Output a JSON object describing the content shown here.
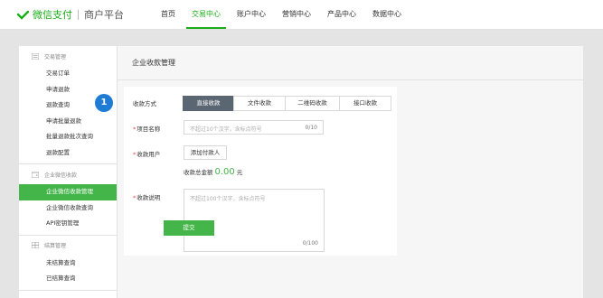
{
  "brand": {
    "name": "微信支付",
    "sub": "商户平台",
    "color": "#1aad19"
  },
  "nav": [
    "首页",
    "交易中心",
    "账户中心",
    "营销中心",
    "产品中心",
    "数据中心"
  ],
  "nav_active_index": 1,
  "sidebar": [
    {
      "title": "交易管理",
      "icon": "list-icon",
      "items": [
        "交易订单",
        "申请退款",
        "退款查询",
        "申请批量退款",
        "批量退款批次查询",
        "退款配置"
      ]
    },
    {
      "title": "企业微信收款",
      "icon": "wallet-icon",
      "items": [
        "企业微信收款管理",
        "企业微信收款查询",
        "API密钥管理"
      ]
    },
    {
      "title": "结算管理",
      "icon": "table-icon",
      "items": [
        "未结算查询",
        "已结算查询"
      ]
    }
  ],
  "sidebar_active": "企业微信收款管理",
  "page_title": "企业收款管理",
  "form": {
    "method_label": "收款方式",
    "method_tabs": [
      "直接收款",
      "文件收款",
      "二维码收款",
      "接口收款"
    ],
    "method_active_index": 0,
    "item_label": "项目名称",
    "item_placeholder": "不超过10个汉字，含标点符号",
    "item_count": "0/10",
    "payer_label": "收款用户",
    "add_payer": "添加付款人",
    "total_label": "收款总金额",
    "total_value": "0.00",
    "total_unit": "元",
    "desc_label": "收款说明",
    "desc_placeholder": "不超过100个汉字，含标点符号",
    "desc_count": "0/100",
    "submit": "提交"
  },
  "step_badge": "1",
  "accent_color": "#44b549"
}
